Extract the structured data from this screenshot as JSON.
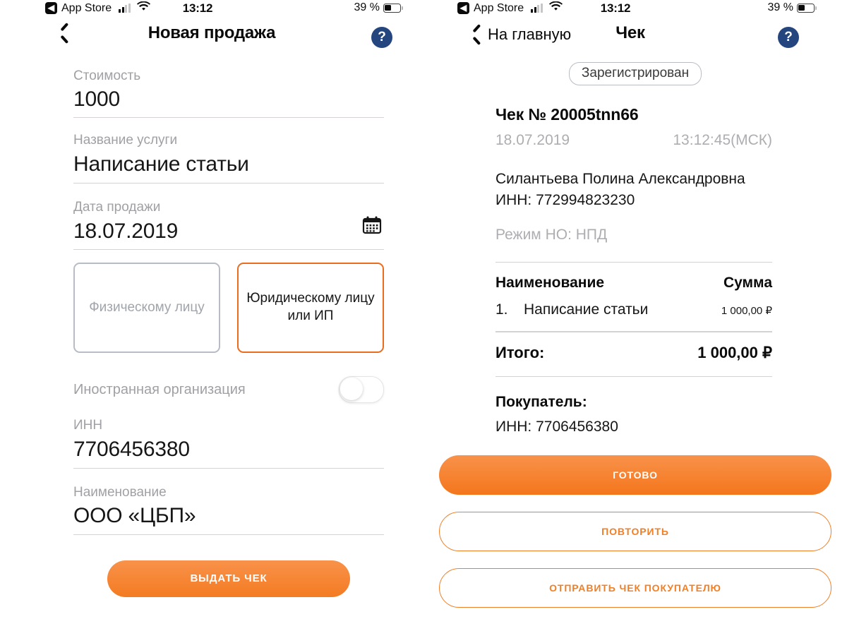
{
  "status_bar": {
    "carrier_back_app": "App Store",
    "time": "13:12",
    "battery_text": "39 %",
    "signal_icon": "cellular-signal-icon",
    "wifi_icon": "wifi-icon",
    "battery_icon": "battery-icon"
  },
  "left_screen": {
    "nav": {
      "back_icon": "chevron-left-icon",
      "back_label": "",
      "title": "Новая продажа",
      "help_label": "?"
    },
    "fields": [
      {
        "label": "Стоимость",
        "value": "1000"
      },
      {
        "label": "Название услуги",
        "value": "Написание статьи"
      },
      {
        "label": "Дата продажи",
        "value": "18.07.2019",
        "icon": "calendar-icon"
      },
      {
        "label": "ИНН",
        "value": "7706456380"
      },
      {
        "label": "Наименование",
        "value": "ООО «ЦБП»"
      }
    ],
    "segments": [
      {
        "label": "Физическому лицу",
        "selected": false
      },
      {
        "label": "Юридическому лицу или ИП",
        "selected": true
      }
    ],
    "toggle": {
      "label": "Иностранная организация",
      "on": false
    },
    "submit_label": "ВЫДАТЬ ЧЕК"
  },
  "right_screen": {
    "nav": {
      "back_icon": "chevron-left-icon",
      "back_label": "На главную",
      "title": "Чек",
      "help_label": "?"
    },
    "status_badge": "Зарегистрирован",
    "receipt": {
      "title": "Чек № 20005tnn66",
      "date": "18.07.2019",
      "time": "13:12:45(МСК)",
      "seller_name": "Силантьева Полина Александровна",
      "seller_inn": "ИНН: 772994823230",
      "tax_regime": "Режим НО: НПД",
      "table_headers": {
        "name": "Наименование",
        "amount": "Сумма"
      },
      "items": [
        {
          "index": "1.",
          "name": "Написание статьи",
          "amount": "1 000,00 ₽"
        }
      ],
      "total_label": "Итого:",
      "total_amount": "1 000,00 ₽",
      "buyer_label": "Покупатель:",
      "buyer_inn": "ИНН: 7706456380"
    },
    "actions": [
      {
        "label": "ГОТОВО",
        "style": "primary"
      },
      {
        "label": "ПОВТОРИТЬ",
        "style": "outline"
      },
      {
        "label": "ОТПРАВИТЬ ЧЕК ПОКУПАТЕЛЮ",
        "style": "outline"
      }
    ]
  },
  "colors": {
    "accent_orange": "#f4791f",
    "help_blue": "#25457e",
    "muted_gray": "#a0a0a5",
    "rule_gray": "#d8d2d4"
  }
}
